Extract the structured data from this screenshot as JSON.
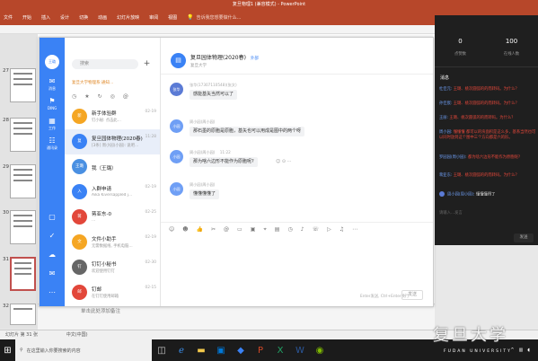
{
  "ppt": {
    "title": "复旦物理1 (兼容模式) - PowerPoint",
    "ribbon_tabs": [
      "文件",
      "开始",
      "插入",
      "设计",
      "切换",
      "动画",
      "幻灯片放映",
      "审阅",
      "视图"
    ],
    "ribbon_search": "告诉我您想要做什么...",
    "slide_numbers": [
      "27",
      "28",
      "29",
      "30",
      "31",
      "32"
    ],
    "notes_placeholder": "单击此处添加备注",
    "status": {
      "slide": "幻灯片 第 31 张",
      "lang": "中文(中国)"
    }
  },
  "taskbar": {
    "search_placeholder": "在这里输入你要搜索的内容"
  },
  "dingtalk": {
    "nav": [
      {
        "label": "消息",
        "icon": "message-icon"
      },
      {
        "label": "DING",
        "icon": "ding-icon"
      },
      {
        "label": "工作",
        "icon": "work-icon"
      },
      {
        "label": "通讯录",
        "icon": "contacts-icon"
      }
    ],
    "search_placeholder": "搜索",
    "notice": "复旦大学物理系:通知...",
    "conversations": [
      {
        "name": "新手体验群",
        "sub": "钉小秘: 点击此…",
        "time": "02-19",
        "avatar": "新",
        "color": "#f5a623"
      },
      {
        "name": "复旦园体物理(2020春)",
        "sub": "[3条] 周小园(小园): 说吧…",
        "time": "11:28",
        "avatar": "复",
        "color": "#3a82f5"
      },
      {
        "name": "我（王璐）",
        "sub": "",
        "time": "",
        "avatar": "王璐",
        "color": "#4a90e2"
      },
      {
        "name": "入群申请",
        "sub": "Aika Kiversappled j...",
        "time": "02-19",
        "avatar": "入",
        "color": "#3a82f5"
      },
      {
        "name": "蒋亚东-0",
        "sub": "…",
        "time": "02-25",
        "avatar": "蒋",
        "color": "#e2473a"
      },
      {
        "name": "文件小助手",
        "sub": "无需数据线, 手机电脑…",
        "time": "02-19",
        "avatar": "文",
        "color": "#f5a623"
      },
      {
        "name": "钉钉小秘书",
        "sub": "欢迎使用钉钉",
        "time": "02-30",
        "avatar": "钉",
        "color": "#666"
      },
      {
        "name": "钉邮",
        "sub": "在钉钉使用邮箱",
        "time": "02-15",
        "avatar": "邮",
        "color": "#e2473a"
      }
    ],
    "chat": {
      "title": "复旦园体物理(2020春)",
      "title_tag": "外部",
      "subtitle": "复旦大学",
      "messages": [
        {
          "sender": "张华(17307110548)(张文)",
          "time": "",
          "text": "感能基矢当然可以了",
          "avatar": "张华",
          "color": "#5b7bd5"
        },
        {
          "sender": "周小园(周小园)",
          "time": "",
          "text": "那石墨的原胞是原胞，基矢也可以用成是图中的两个呀",
          "avatar": "小园",
          "color": "#6f9ff5"
        },
        {
          "sender": "周小园(周小园)",
          "time": "11:22",
          "text": "那为啥六边形不能作为原胞呢?",
          "avatar": "小园",
          "color": "#6f9ff5"
        },
        {
          "sender": "周小园(周小园)",
          "time": "",
          "text": "懂懂懂懂了",
          "avatar": "小园",
          "color": "#6f9ff5"
        }
      ],
      "hint": "Enter发送, Ctrl+Enter换行",
      "send_label": "发送"
    }
  },
  "live": {
    "stats": [
      {
        "value": "0",
        "label": "点赞数"
      },
      {
        "value": "100",
        "label": "在线人数"
      }
    ],
    "tab": "消息",
    "messages": [
      {
        "name": "杜佳元:",
        "text": "王璐、桃次圆弧的的而转码。为什么？",
        "style": "red"
      },
      {
        "name": "孙佳宸:",
        "text": "王璐、桃次圆弧的的而转码。为什么？",
        "style": "red"
      },
      {
        "name": "王丽:",
        "text": "王璐、桃次圆弧的的而转码。为什么？",
        "style": "red"
      },
      {
        "name": "周小园:",
        "text": "懂懂懂 都可以的块面积是这么多，基系当然也可以同时放到这个图中三个方向都是六的形。",
        "style": "red"
      },
      {
        "name": "罗园园(周小园):",
        "text": "都为啥六边形不能作为原胞呢?",
        "style": "red"
      },
      {
        "name": "蒋亚东:",
        "text": "王璐、桃次圆弧的的而转码。为什么？",
        "style": "red"
      },
      {
        "name": "周小园(周小园):",
        "text": "懂懂懂得了",
        "style": "white"
      }
    ],
    "input_placeholder": "请输入…发言",
    "send_label": "发送"
  },
  "watermark": {
    "main": "复旦大学",
    "sub": "FUDAN UNIVERSITY"
  }
}
